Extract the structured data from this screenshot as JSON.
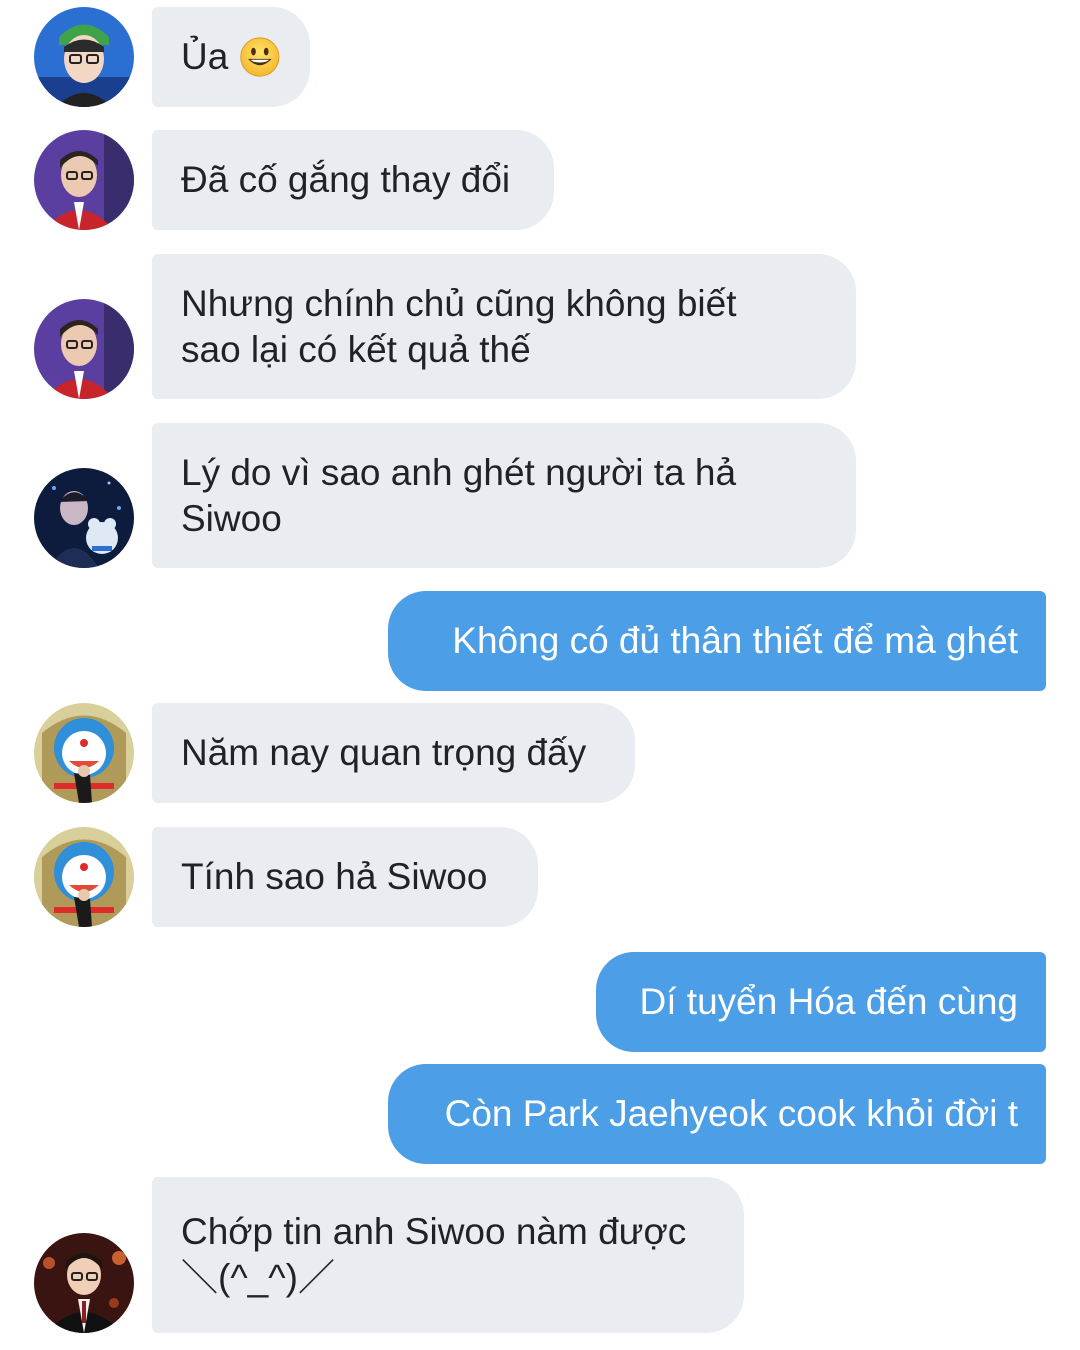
{
  "messages": [
    {
      "direction": "incoming",
      "text": "Ủa",
      "emoji": "grinning-face-icon",
      "avatar": "avatar-green-hat"
    },
    {
      "direction": "incoming",
      "text": "Đã cố gắng thay đổi",
      "avatar": "avatar-red-jacket"
    },
    {
      "direction": "incoming",
      "text": "Nhưng chính chủ cũng không biết\nsao lại có kết quả thế",
      "avatar": "avatar-red-jacket"
    },
    {
      "direction": "incoming",
      "text": "Lý do vì sao anh ghét người ta hả\nSiwoo",
      "avatar": "avatar-dark-blue-plush"
    },
    {
      "direction": "outgoing",
      "text": "Không có đủ thân thiết để mà ghét"
    },
    {
      "direction": "incoming",
      "text": "Năm nay quan trọng đấy",
      "avatar": "avatar-doraemon"
    },
    {
      "direction": "incoming",
      "text": "Tính sao hả Siwoo",
      "avatar": "avatar-doraemon"
    },
    {
      "direction": "outgoing",
      "text": "Dí tuyển Hóa đến cùng"
    },
    {
      "direction": "outgoing",
      "text": "Còn Park Jaehyeok cook khỏi đời t"
    },
    {
      "direction": "incoming",
      "text": "Chớp tin anh Siwoo nàm được\n＼(^_^)／",
      "avatar": "avatar-dark-red"
    }
  ],
  "colors": {
    "incoming_bubble": "#e9ecf0",
    "outgoing_bubble": "#4c9fe6",
    "incoming_text": "#1f2226",
    "outgoing_text": "#ffffff",
    "background": "#ffffff"
  }
}
